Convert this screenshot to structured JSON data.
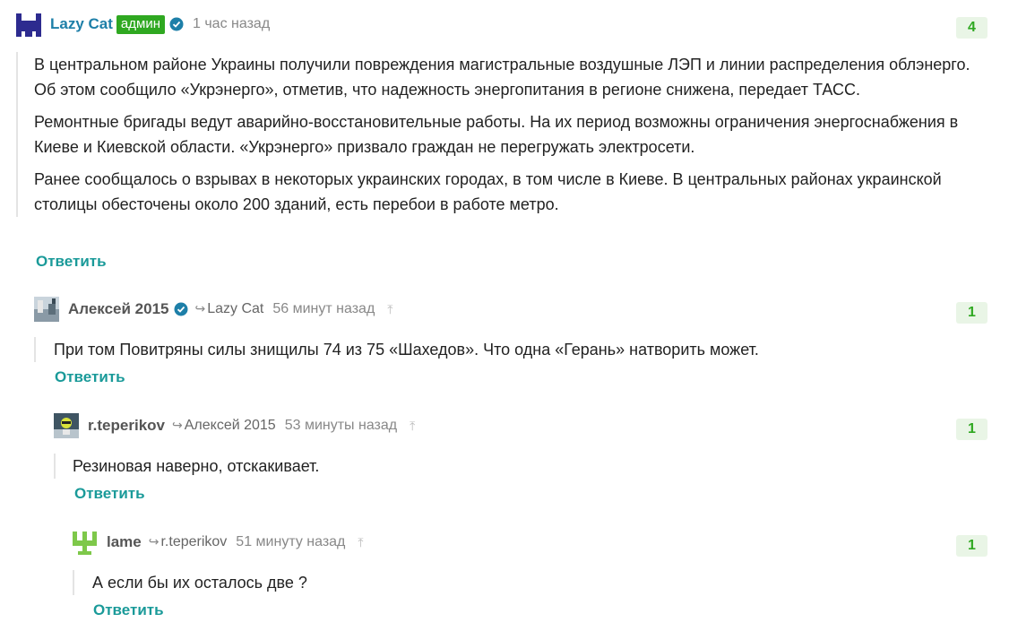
{
  "comments": [
    {
      "author": "Lazy Cat",
      "role_badge": "админ",
      "time": "1 час назад",
      "score": "4",
      "paragraphs": [
        "В центральном районе Украины получили повреждения магистральные воздушные ЛЭП и линии распределения облэнерго. Об этом сообщило «Укрэнерго», отметив, что надежность энергопитания в регионе снижена, передает ТАСС.",
        "Ремонтные бригады ведут аварийно-восстановительные работы. На их период возможны ограничения энергоснабжения в Киеве и Киевской области. «Укрэнерго» призвало граждан не перегружать электросети.",
        "Ранее сообщалось о взрывах в некоторых украинских городах, в том числе в Киеве. В центральных районах украинской столицы обесточены около 200 зданий, есть перебои в работе метро."
      ],
      "reply_label": "Ответить"
    },
    {
      "author": "Алексей 2015",
      "reply_to": "Lazy Cat",
      "time": "56 минут назад",
      "score": "1",
      "text": "При том Повитряны силы знищилы 74 из 75 «Шахедов». Что одна «Герань» натворить может.",
      "reply_label": "Ответить"
    },
    {
      "author": "r.teperikov",
      "reply_to": "Алексей 2015",
      "time": "53 минуты назад",
      "score": "1",
      "text": "Резиновая наверно, отскакивает.",
      "reply_label": "Ответить"
    },
    {
      "author": "lame",
      "reply_to": "r.teperikov",
      "time": "51 минуту назад",
      "score": "1",
      "text": "А если бы их осталось две ?",
      "reply_label": "Ответить"
    }
  ],
  "colors": {
    "admin_name": "#1d7fa8",
    "badge_bg": "#2fa821",
    "score_bg": "#e9f5e6",
    "score_text": "#2fa821",
    "reply_link": "#1a9a99"
  },
  "icons": {
    "verified": "verified-check-icon",
    "reply_arrow": "reply-arrow-icon",
    "pin": "scroll-to-parent-icon"
  }
}
